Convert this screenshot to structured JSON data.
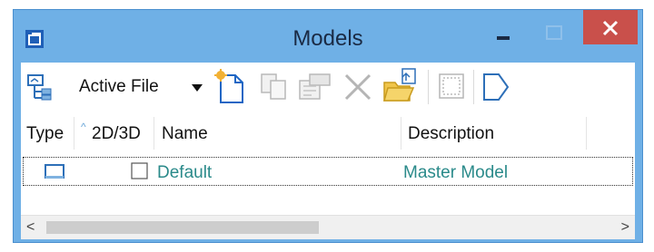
{
  "window": {
    "title": "Models"
  },
  "toolbar": {
    "active_file_label": "Active File",
    "icons": [
      "model-tree-icon",
      "new-model-icon",
      "copy-model-icon",
      "properties-icon",
      "delete-icon",
      "import-icon",
      "select-icon",
      "sheet-icon"
    ]
  },
  "columns": {
    "type": "Type",
    "dimension": "2D/3D",
    "name": "Name",
    "description": "Description"
  },
  "rows": [
    {
      "type_icon": "design-model-icon",
      "is_3d": false,
      "name": "Default",
      "description": "Master Model"
    }
  ],
  "colors": {
    "title_bar": "#6fb0e6",
    "close_button": "#c9504b",
    "row_text": "#2a8a8a"
  }
}
